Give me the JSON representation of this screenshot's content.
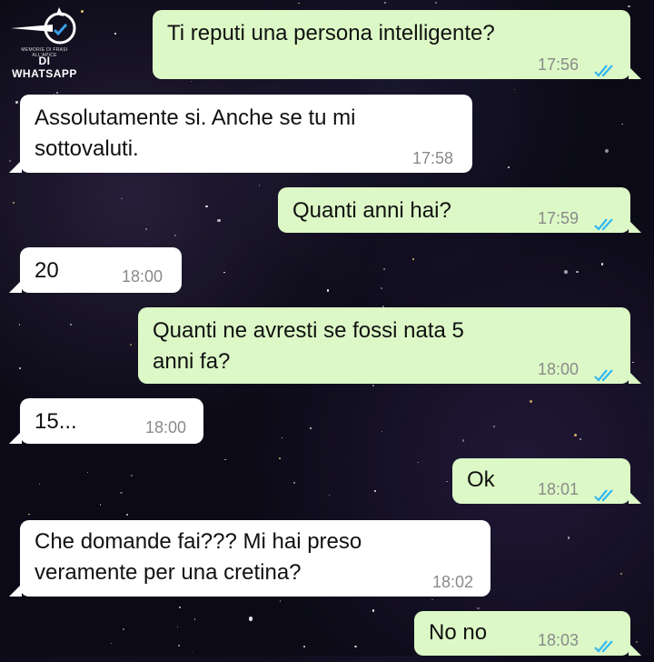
{
  "logo": {
    "text": "DI WHATSAPP",
    "sub": "MEMORIE DI FRASI ALL'APICE"
  },
  "colors": {
    "outgoing": "#dcf8c6",
    "incoming": "#ffffff",
    "ticks": "#34b7f1",
    "background": "#0b0a16"
  },
  "messages": [
    {
      "dir": "out",
      "text": "Ti reputi una persona intelligente?",
      "time": "17:56",
      "ticks": "double-check-read-icon"
    },
    {
      "dir": "in",
      "line1": "Assolutamente si. Anche se tu mi",
      "line2": "sottovaluti.",
      "time": "17:58"
    },
    {
      "dir": "out",
      "text": "Quanti anni hai?",
      "time": "17:59",
      "ticks": "double-check-read-icon"
    },
    {
      "dir": "in",
      "text": "20",
      "time": "18:00"
    },
    {
      "dir": "out",
      "line1": "Quanti ne avresti se fossi nata 5",
      "line2": "anni fa?",
      "time": "18:00",
      "ticks": "double-check-read-icon"
    },
    {
      "dir": "in",
      "text": "15...",
      "time": "18:00"
    },
    {
      "dir": "out",
      "text": "Ok",
      "time": "18:01",
      "ticks": "double-check-read-icon"
    },
    {
      "dir": "in",
      "line1": "Che domande fai??? Mi hai preso",
      "line2": "veramente per una cretina?",
      "time": "18:02"
    },
    {
      "dir": "out",
      "text": "No no",
      "time": "18:03",
      "ticks": "double-check-read-icon"
    }
  ]
}
